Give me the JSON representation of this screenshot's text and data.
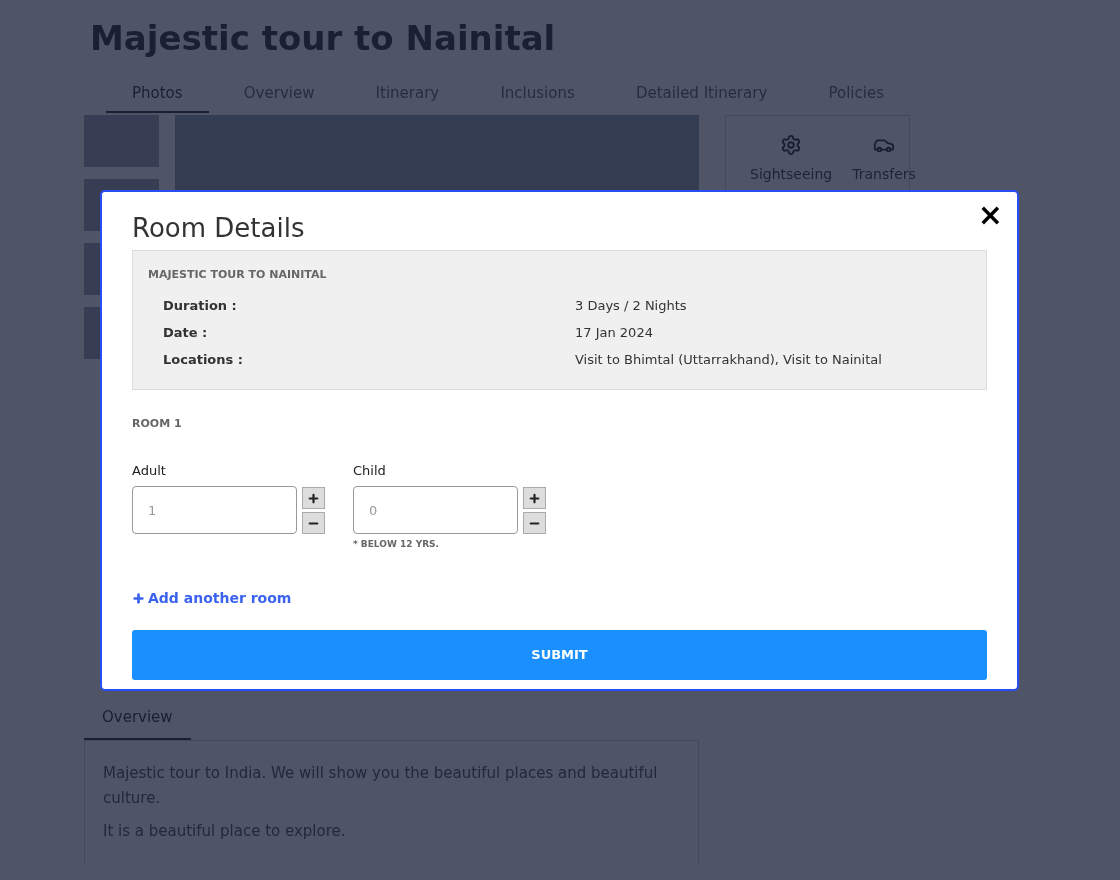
{
  "page": {
    "title": "Majestic tour to Nainital",
    "tabs": [
      {
        "label": "Photos",
        "selected": true
      },
      {
        "label": "Overview",
        "selected": false
      },
      {
        "label": "Itinerary",
        "selected": false
      },
      {
        "label": "Inclusions",
        "selected": false
      },
      {
        "label": "Detailed Itinerary",
        "selected": false
      },
      {
        "label": "Policies",
        "selected": false
      }
    ],
    "features": [
      {
        "kind": "sightseeing",
        "label": "Sightseeing"
      },
      {
        "kind": "transfers",
        "label": "Transfers"
      }
    ],
    "overview": {
      "heading": "Overview",
      "paragraphs": [
        "Majestic tour to India. We will show you the beautiful places and beautiful culture.",
        "It is a beautiful place to explore."
      ]
    }
  },
  "modal": {
    "title": "Room Details",
    "close": "×",
    "summary": {
      "heading": "MAJESTIC TOUR TO NAINITAL",
      "rows": [
        {
          "label": "Duration :",
          "value": "3 Days / 2 Nights"
        },
        {
          "label": "Date :",
          "value": "17 Jan 2024"
        },
        {
          "label": "Locations :",
          "value": "Visit to Bhimtal (Uttarrakhand), Visit to Nainital"
        }
      ]
    },
    "rooms": [
      {
        "heading": "ROOM 1",
        "fields": [
          {
            "label": "Adult",
            "placeholder": "1"
          },
          {
            "label": "Child",
            "placeholder": "0",
            "note": "* BELOW 12 YRS."
          }
        ]
      }
    ],
    "add_room": "Add another room",
    "submit": "SUBMIT"
  }
}
